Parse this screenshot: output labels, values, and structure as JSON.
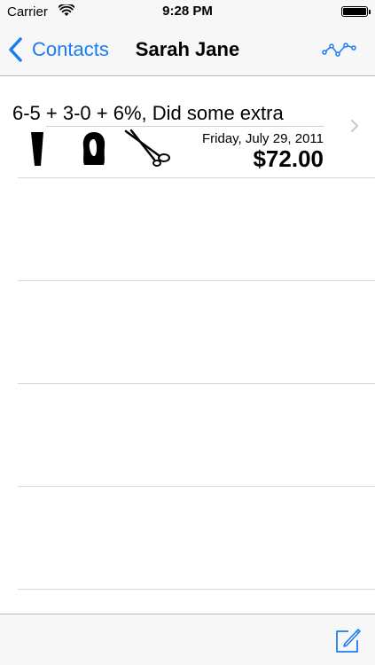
{
  "status_bar": {
    "carrier": "Carrier",
    "time": "9:28 PM",
    "wifi_icon": "wifi-icon",
    "battery_icon": "battery-full-icon"
  },
  "nav": {
    "back_label": "Contacts",
    "back_icon": "chevron-left-icon",
    "title": "Sarah Jane",
    "right_icon": "line-graph-icon"
  },
  "visits": [
    {
      "title": "6-5 + 3-0 + 6%, Did some extra",
      "date": "Friday, July 29, 2011",
      "amount": "$72.00",
      "service_icons": [
        "hair-color-tube-icon",
        "hair-silhouette-icon",
        "scissors-icon"
      ]
    }
  ],
  "toolbar": {
    "compose_icon": "compose-icon"
  },
  "colors": {
    "accent": "#1a7cf5",
    "bar_background": "#f7f7f7",
    "separator": "#d8d8d8"
  }
}
